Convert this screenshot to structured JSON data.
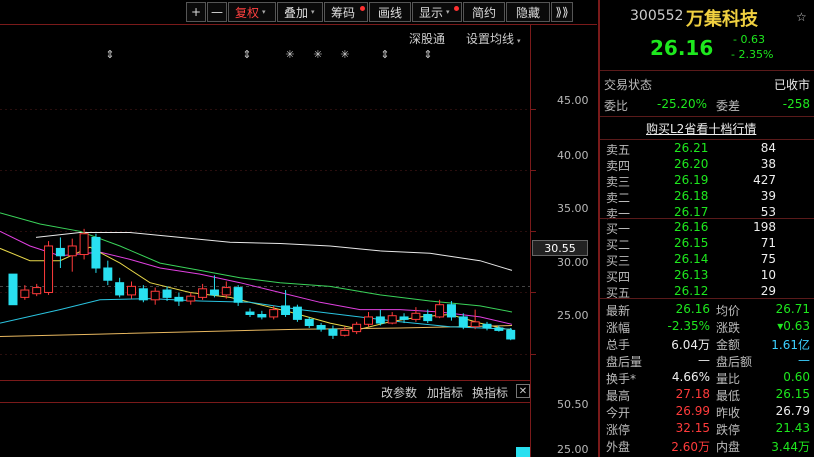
{
  "toolbar": {
    "items": [
      {
        "label": "+",
        "width": 20,
        "caret": false,
        "dot": false,
        "active": false,
        "name": "zoom-in-button"
      },
      {
        "label": "—",
        "width": 20,
        "caret": false,
        "dot": false,
        "active": false,
        "name": "zoom-out-button"
      },
      {
        "label": "复权",
        "width": 48,
        "caret": true,
        "dot": false,
        "active": true,
        "name": "adjust-button"
      },
      {
        "label": "叠加",
        "width": 46,
        "caret": true,
        "dot": false,
        "active": false,
        "name": "overlay-button"
      },
      {
        "label": "筹码",
        "width": 44,
        "caret": false,
        "dot": true,
        "active": false,
        "name": "chips-button"
      },
      {
        "label": "画线",
        "width": 42,
        "caret": false,
        "dot": false,
        "active": false,
        "name": "draw-line-button"
      },
      {
        "label": "显示",
        "width": 50,
        "caret": true,
        "dot": true,
        "active": false,
        "name": "display-button"
      },
      {
        "label": "简约",
        "width": 42,
        "caret": false,
        "dot": false,
        "active": false,
        "name": "simple-button"
      },
      {
        "label": "隐藏",
        "width": 44,
        "caret": false,
        "dot": false,
        "active": false,
        "name": "hide-button"
      },
      {
        "label": "⟫⟫",
        "width": 22,
        "caret": false,
        "dot": false,
        "active": false,
        "name": "expand-button"
      }
    ],
    "shen_gu_tong": "深股通",
    "ma_settings": "设置均线",
    "ma_caret": "▾"
  },
  "indicator_bar": {
    "params": "改参数",
    "add": "加指标",
    "switch": "换指标",
    "close": "✕"
  },
  "yaxis": {
    "main": [
      "45.00",
      "40.00",
      "35.00",
      "30.00",
      "25.00"
    ],
    "lower": [
      "50.50",
      "25.00"
    ]
  },
  "current_price_tag": "30.55",
  "chart_data": {
    "type": "candlestick",
    "ylim": [
      23.5,
      49
    ],
    "yticks": [
      45,
      40,
      35,
      30,
      25
    ],
    "current_line": 30.55,
    "markers": [
      {
        "x": 110,
        "s": "⇕"
      },
      {
        "x": 247,
        "s": "⇕"
      },
      {
        "x": 290,
        "s": "✳"
      },
      {
        "x": 318,
        "s": "✳"
      },
      {
        "x": 345,
        "s": "✳"
      },
      {
        "x": 385,
        "s": "⇕"
      },
      {
        "x": 428,
        "s": "⇕"
      }
    ],
    "candles": [
      [
        31.5,
        29.0,
        31.5,
        29.0
      ],
      [
        29.6,
        30.2,
        30.6,
        29.4
      ],
      [
        29.9,
        30.4,
        30.7,
        29.7
      ],
      [
        30.0,
        33.8,
        34.2,
        29.8
      ],
      [
        33.6,
        33.0,
        34.5,
        32.0
      ],
      [
        33.0,
        33.8,
        34.4,
        31.7
      ],
      [
        33.1,
        34.8,
        35.2,
        32.7
      ],
      [
        34.5,
        32.0,
        34.8,
        31.6
      ],
      [
        32.0,
        31.0,
        32.6,
        30.6
      ],
      [
        30.8,
        29.8,
        31.2,
        29.6
      ],
      [
        29.8,
        30.5,
        30.9,
        29.5
      ],
      [
        30.3,
        29.4,
        30.6,
        29.2
      ],
      [
        29.4,
        30.1,
        30.4,
        29.0
      ],
      [
        30.2,
        29.6,
        30.5,
        29.3
      ],
      [
        29.6,
        29.3,
        30.0,
        28.9
      ],
      [
        29.3,
        29.7,
        30.0,
        29.0
      ],
      [
        29.6,
        30.3,
        30.7,
        29.4
      ],
      [
        30.2,
        29.8,
        31.4,
        29.6
      ],
      [
        29.8,
        30.4,
        30.9,
        29.5
      ],
      [
        30.4,
        29.2,
        30.6,
        28.9
      ],
      [
        28.4,
        28.2,
        28.7,
        28.0
      ],
      [
        28.2,
        28.0,
        28.5,
        27.8
      ],
      [
        28.0,
        28.6,
        28.9,
        27.8
      ],
      [
        28.9,
        28.2,
        30.2,
        28.0
      ],
      [
        28.8,
        27.8,
        29.0,
        27.6
      ],
      [
        27.8,
        27.3,
        28.0,
        27.1
      ],
      [
        27.3,
        27.0,
        27.5,
        26.8
      ],
      [
        27.0,
        26.5,
        27.3,
        26.2
      ],
      [
        26.5,
        26.9,
        27.2,
        26.4
      ],
      [
        26.8,
        27.4,
        27.6,
        26.6
      ],
      [
        27.4,
        28.0,
        28.4,
        27.2
      ],
      [
        28.0,
        27.5,
        28.6,
        27.3
      ],
      [
        27.5,
        28.1,
        28.4,
        27.4
      ],
      [
        28.0,
        27.8,
        28.3,
        27.5
      ],
      [
        27.8,
        28.3,
        28.8,
        27.6
      ],
      [
        28.2,
        27.7,
        28.6,
        27.5
      ],
      [
        28.0,
        29.0,
        29.4,
        27.9
      ],
      [
        29.0,
        28.0,
        29.3,
        27.7
      ],
      [
        28.0,
        27.2,
        28.3,
        27.0
      ],
      [
        27.2,
        27.6,
        28.6,
        27.0
      ],
      [
        27.4,
        27.1,
        27.6,
        26.9
      ],
      [
        27.1,
        26.9,
        27.3,
        26.8
      ],
      [
        26.9,
        26.2,
        27.1,
        26.1
      ]
    ],
    "lines": [
      {
        "color": "#e8e8e8",
        "pts": [
          [
            36,
            34.5
          ],
          [
            80,
            34.9
          ],
          [
            130,
            34.9
          ],
          [
            180,
            34.5
          ],
          [
            230,
            34.1
          ],
          [
            280,
            34.0
          ],
          [
            330,
            33.8
          ],
          [
            380,
            33.4
          ],
          [
            430,
            33.2
          ],
          [
            480,
            32.6
          ],
          [
            512,
            31.8
          ]
        ]
      },
      {
        "color": "#3ad35a",
        "pts": [
          [
            0,
            36.5
          ],
          [
            40,
            35.6
          ],
          [
            80,
            35.0
          ],
          [
            120,
            33.8
          ],
          [
            160,
            32.4
          ],
          [
            200,
            31.8
          ],
          [
            240,
            31.2
          ],
          [
            280,
            30.8
          ],
          [
            330,
            30.5
          ],
          [
            380,
            29.8
          ],
          [
            430,
            29.3
          ],
          [
            480,
            28.9
          ],
          [
            512,
            28.4
          ]
        ]
      },
      {
        "color": "#e040e0",
        "pts": [
          [
            0,
            35.0
          ],
          [
            30,
            33.8
          ],
          [
            60,
            33.0
          ],
          [
            100,
            33.3
          ],
          [
            130,
            32.7
          ],
          [
            160,
            32.0
          ],
          [
            200,
            31.5
          ],
          [
            240,
            30.8
          ],
          [
            280,
            30.0
          ],
          [
            320,
            29.2
          ],
          [
            360,
            28.6
          ],
          [
            400,
            28.6
          ],
          [
            440,
            28.4
          ],
          [
            480,
            28.0
          ],
          [
            512,
            27.4
          ]
        ]
      },
      {
        "color": "#e8d84a",
        "pts": [
          [
            0,
            33.6
          ],
          [
            30,
            32.6
          ],
          [
            60,
            32.6
          ],
          [
            90,
            33.7
          ],
          [
            120,
            32.4
          ],
          [
            150,
            30.8
          ],
          [
            190,
            30.0
          ],
          [
            230,
            29.6
          ],
          [
            260,
            29.0
          ],
          [
            290,
            28.4
          ],
          [
            330,
            27.5
          ],
          [
            360,
            27.0
          ],
          [
            390,
            27.6
          ],
          [
            420,
            28.0
          ],
          [
            450,
            28.2
          ],
          [
            480,
            27.5
          ],
          [
            512,
            26.9
          ]
        ]
      },
      {
        "color": "#e8b860",
        "pts": [
          [
            0,
            26.4
          ],
          [
            100,
            26.6
          ],
          [
            200,
            26.8
          ],
          [
            300,
            27.0
          ],
          [
            400,
            27.1
          ],
          [
            512,
            27.3
          ]
        ]
      },
      {
        "color": "#2ac4e0",
        "pts": [
          [
            0,
            27.5
          ],
          [
            60,
            28.6
          ],
          [
            100,
            29.4
          ],
          [
            150,
            29.5
          ],
          [
            200,
            29.3
          ],
          [
            250,
            29.2
          ],
          [
            300,
            28.6
          ],
          [
            350,
            28.1
          ],
          [
            400,
            27.6
          ],
          [
            450,
            27.2
          ],
          [
            512,
            27.0
          ]
        ]
      }
    ]
  },
  "panel": {
    "code": "300552",
    "name": "万集科技",
    "price": "26.16",
    "change": "- 0.63",
    "change_pct": "- 2.35%",
    "trade_status_label": "交易状态",
    "trade_status": "已收市",
    "wei_bi_label": "委比",
    "wei_bi": "-25.20%",
    "wei_cha_label": "委差",
    "wei_cha": "-258",
    "buy_l2": "购买L2省看十档行情",
    "asks": [
      {
        "label": "卖五",
        "price": "26.21",
        "vol": "84"
      },
      {
        "label": "卖四",
        "price": "26.20",
        "vol": "38"
      },
      {
        "label": "卖三",
        "price": "26.19",
        "vol": "427"
      },
      {
        "label": "卖二",
        "price": "26.18",
        "vol": "39"
      },
      {
        "label": "卖一",
        "price": "26.17",
        "vol": "53"
      }
    ],
    "bids": [
      {
        "label": "买一",
        "price": "26.16",
        "vol": "198"
      },
      {
        "label": "买二",
        "price": "26.15",
        "vol": "71"
      },
      {
        "label": "买三",
        "price": "26.14",
        "vol": "75"
      },
      {
        "label": "买四",
        "price": "26.13",
        "vol": "10"
      },
      {
        "label": "买五",
        "price": "26.12",
        "vol": "29"
      }
    ],
    "stats": [
      {
        "l1": "最新",
        "v1": "26.16",
        "c1": "green",
        "l2": "均价",
        "v2": "26.71",
        "c2": "green"
      },
      {
        "l1": "涨幅",
        "v1": "-2.35%",
        "c1": "green",
        "l2": "涨跌",
        "v2": "▾0.63",
        "c2": "green"
      },
      {
        "l1": "总手",
        "v1": "6.04万",
        "c1": "white",
        "l2": "金额",
        "v2": "1.61亿",
        "c2": "cyan"
      },
      {
        "l1": "盘后量",
        "v1": "—",
        "c1": "white",
        "l2": "盘后额",
        "v2": "—",
        "c2": "cyan"
      },
      {
        "l1": "换手*",
        "v1": "4.66%",
        "c1": "white",
        "l2": "量比",
        "v2": "0.60",
        "c2": "green"
      },
      {
        "l1": "最高",
        "v1": "27.18",
        "c1": "red",
        "l2": "最低",
        "v2": "26.15",
        "c2": "green"
      },
      {
        "l1": "今开",
        "v1": "26.99",
        "c1": "red",
        "l2": "昨收",
        "v2": "26.79",
        "c2": "white"
      },
      {
        "l1": "涨停",
        "v1": "32.15",
        "c1": "red",
        "l2": "跌停",
        "v2": "21.43",
        "c2": "green"
      },
      {
        "l1": "外盘",
        "v1": "2.60万",
        "c1": "red",
        "l2": "内盘",
        "v2": "3.44万",
        "c2": "green"
      }
    ]
  }
}
